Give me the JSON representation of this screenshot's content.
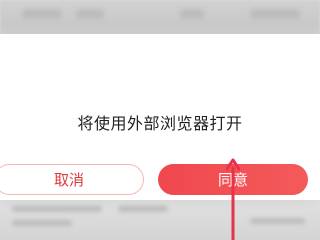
{
  "dialog": {
    "message": "将使用外部浏览器打开",
    "cancel_label": "取消",
    "agree_label": "同意"
  },
  "colors": {
    "accent": "#f0484f",
    "cancel_text": "#e03a3a",
    "arrow": "#e8324a"
  },
  "icons": {
    "pointer": "up-arrow-icon"
  }
}
